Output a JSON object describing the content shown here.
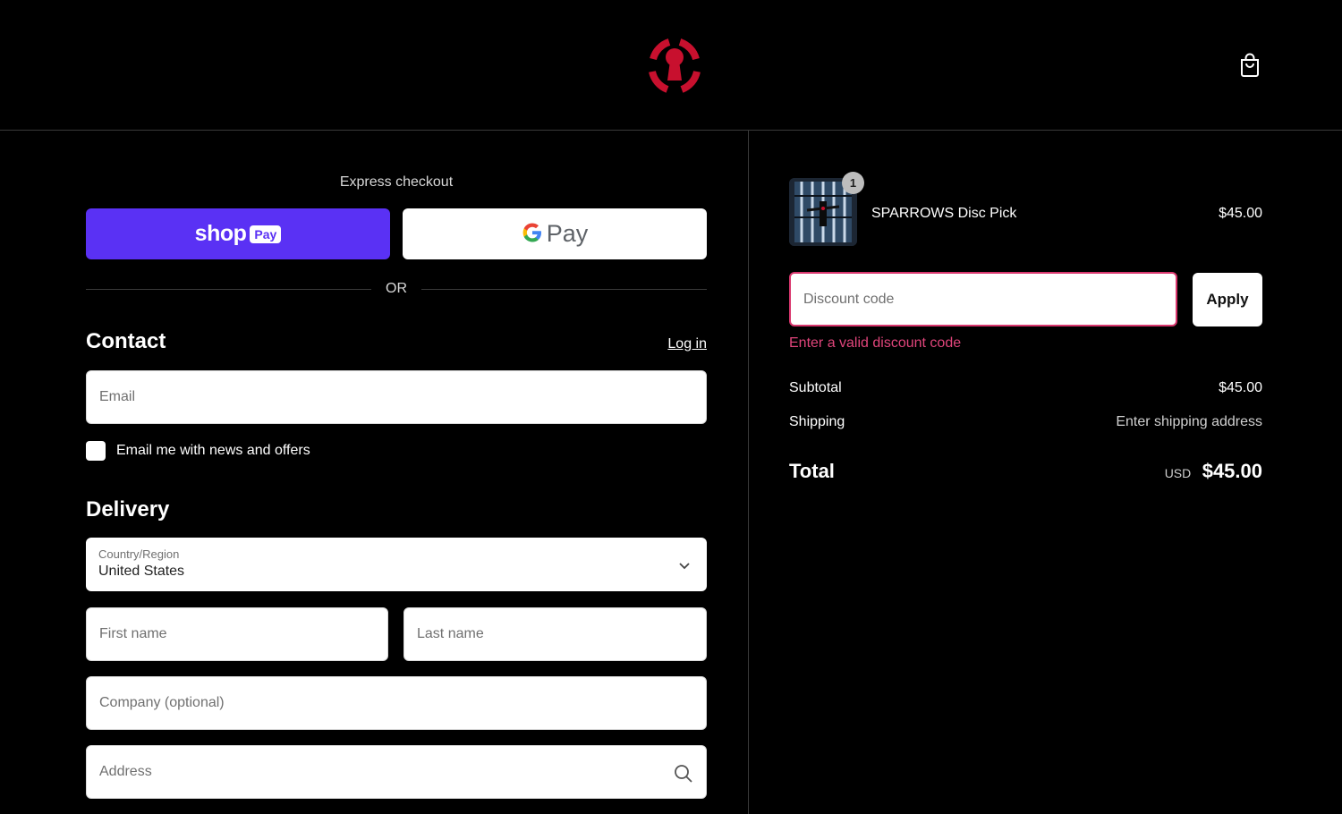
{
  "header": {
    "logo_icon": "keyhole-logo-icon",
    "cart_icon": "shopping-bag-icon",
    "brand_color": "#c8102e"
  },
  "express": {
    "title": "Express checkout",
    "shop_pay": {
      "word": "shop",
      "chip": "Pay",
      "color": "#5a31f4"
    },
    "gpay": {
      "text": "Pay"
    },
    "or_text": "OR"
  },
  "contact": {
    "heading": "Contact",
    "login_label": "Log in",
    "email_placeholder": "Email",
    "newsletter_label": "Email me with news and offers"
  },
  "delivery": {
    "heading": "Delivery",
    "country_label": "Country/Region",
    "country_value": "United States",
    "first_name_placeholder": "First name",
    "last_name_placeholder": "Last name",
    "company_placeholder": "Company (optional)",
    "address_placeholder": "Address"
  },
  "order": {
    "item": {
      "name": "SPARROWS Disc Pick",
      "price": "$45.00",
      "quantity": "1"
    },
    "discount_placeholder": "Discount code",
    "apply_label": "Apply",
    "error_message": "Enter a valid discount code",
    "error_color": "#e0457b",
    "subtotal_label": "Subtotal",
    "subtotal_value": "$45.00",
    "shipping_label": "Shipping",
    "shipping_value": "Enter shipping address",
    "total_label": "Total",
    "currency": "USD",
    "total_value": "$45.00"
  }
}
